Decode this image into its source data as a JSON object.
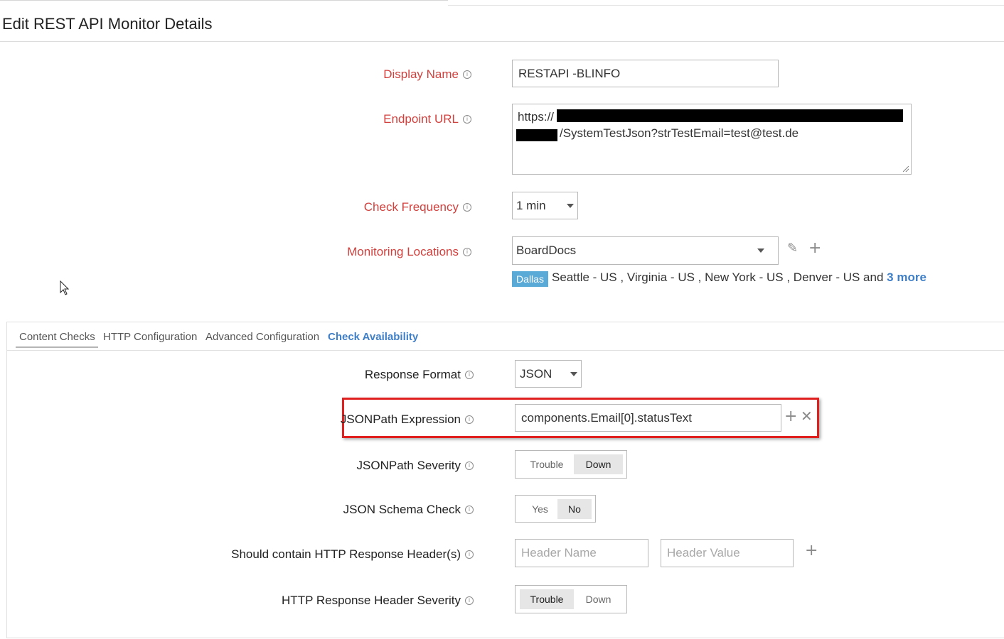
{
  "page": {
    "title": "Edit REST API Monitor Details"
  },
  "display_name": {
    "label": "Display Name",
    "value": "RESTAPI -BLINFO"
  },
  "endpoint_url": {
    "label": "Endpoint URL",
    "line1": "https://",
    "line2": "/SystemTestJson?strTestEmail=test@test.de"
  },
  "check_frequency": {
    "label": "Check Frequency",
    "value": "1 min"
  },
  "monitoring_locations": {
    "label": "Monitoring Locations",
    "value": "BoardDocs",
    "primary_tag": "Dallas",
    "others": "Seattle - US , Virginia - US , New York - US , Denver - US and",
    "more_link": "3 more",
    "edit_icon": "pencil-icon",
    "add_icon": "plus-icon"
  },
  "tabs": [
    {
      "label": "Content Checks"
    },
    {
      "label": "HTTP Configuration"
    },
    {
      "label": "Advanced Configuration"
    },
    {
      "label": "Check Availability"
    }
  ],
  "response_format": {
    "label": "Response Format",
    "value": "JSON"
  },
  "jsonpath_expression": {
    "label": "JSONPath Expression",
    "value": "components.Email[0].statusText"
  },
  "jsonpath_severity": {
    "label": "JSONPath Severity",
    "options": [
      "Trouble",
      "Down"
    ],
    "selected": "Down"
  },
  "json_schema_check": {
    "label": "JSON Schema Check",
    "options": [
      "Yes",
      "No"
    ],
    "selected": "No"
  },
  "response_headers": {
    "label": "Should contain HTTP Response Header(s)",
    "name_placeholder": "Header Name",
    "value_placeholder": "Header Value"
  },
  "header_severity": {
    "label": "HTTP Response Header Severity",
    "options": [
      "Trouble",
      "Down"
    ],
    "selected": "Trouble"
  },
  "colors": {
    "label_red": "#d0413e",
    "link_blue": "#3f7fc7",
    "tag_blue": "#5aaad8",
    "highlight_red": "#e01f1f"
  }
}
